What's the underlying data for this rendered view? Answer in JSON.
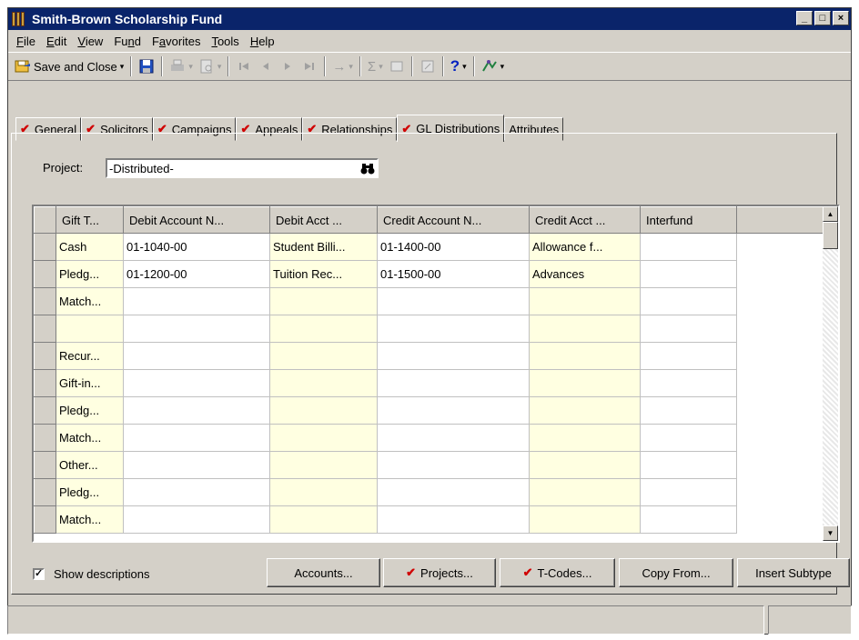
{
  "window": {
    "title": "Smith-Brown Scholarship Fund",
    "controls": [
      "_",
      "□",
      "×"
    ]
  },
  "menu": [
    {
      "label": "File",
      "u": "F"
    },
    {
      "label": "Edit",
      "u": "E"
    },
    {
      "label": "View",
      "u": "V"
    },
    {
      "label": "Fund",
      "u": "n"
    },
    {
      "label": "Favorites",
      "u": "a"
    },
    {
      "label": "Tools",
      "u": "T"
    },
    {
      "label": "Help",
      "u": "H"
    }
  ],
  "toolbar": {
    "save_close_label": "Save and Close",
    "caret": "▾",
    "sigma": "Σ",
    "arrow": "→",
    "help": "?"
  },
  "tabs": [
    {
      "label": "General",
      "checked": true
    },
    {
      "label": "Solicitors",
      "checked": true
    },
    {
      "label": "Campaigns",
      "checked": true
    },
    {
      "label": "Appeals",
      "checked": true
    },
    {
      "label": "Relationships",
      "checked": true
    },
    {
      "label": "GL Distributions",
      "checked": true,
      "active": true
    },
    {
      "label": "Attributes",
      "checked": false
    }
  ],
  "check_mark": "✔",
  "project": {
    "label": "Project:",
    "value": "-Distributed-"
  },
  "grid": {
    "columns": [
      "Gift T...",
      "Debit Account N...",
      "Debit Acct ...",
      "Credit Account N...",
      "Credit Acct ...",
      "Interfund"
    ],
    "rows": [
      [
        "Cash",
        "01-1040-00",
        "Student Billi...",
        "01-1400-00",
        "Allowance f...",
        ""
      ],
      [
        "Pledg...",
        "01-1200-00",
        "Tuition Rec...",
        "01-1500-00",
        "Advances",
        ""
      ],
      [
        "Match...",
        "",
        "",
        "",
        "",
        ""
      ],
      [
        "",
        "",
        "",
        "",
        "",
        ""
      ],
      [
        "Recur...",
        "",
        "",
        "",
        "",
        ""
      ],
      [
        "Gift-in...",
        "",
        "",
        "",
        "",
        ""
      ],
      [
        "Pledg...",
        "",
        "",
        "",
        "",
        ""
      ],
      [
        "Match...",
        "",
        "",
        "",
        "",
        ""
      ],
      [
        "Other...",
        "",
        "",
        "",
        "",
        ""
      ],
      [
        "Pledg...",
        "",
        "",
        "",
        "",
        ""
      ],
      [
        "Match...",
        "",
        "",
        "",
        "",
        ""
      ]
    ]
  },
  "show_descriptions": {
    "label": "Show descriptions",
    "checked": true
  },
  "buttons": {
    "accounts": "Accounts...",
    "projects": "Projects...",
    "tcodes": "T-Codes...",
    "copy_from": "Copy From...",
    "insert_subtype": "Insert Subtype"
  }
}
